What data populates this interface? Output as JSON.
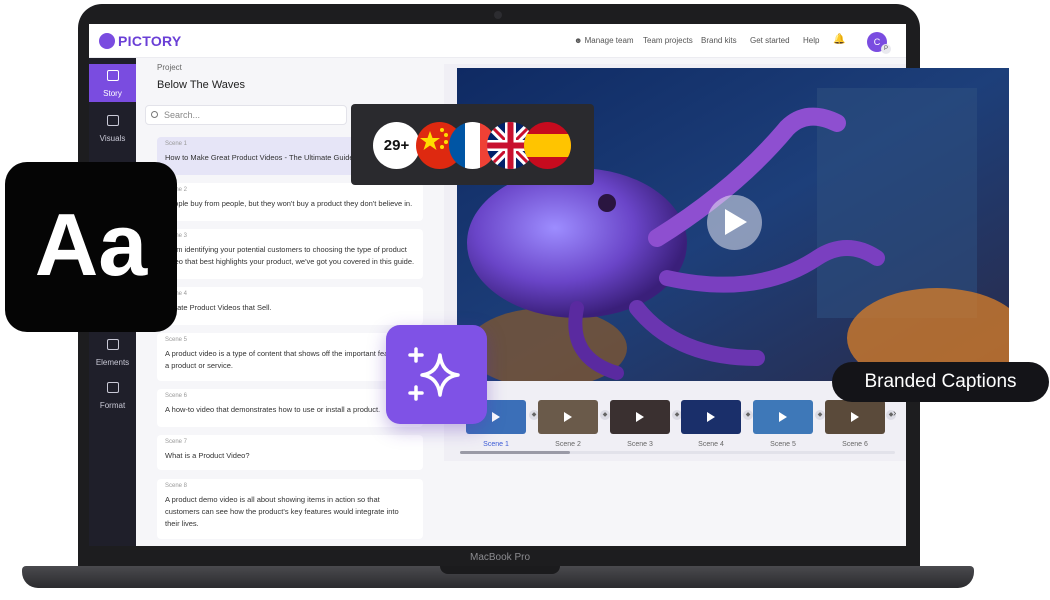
{
  "app": {
    "name": "PICTORY"
  },
  "device": {
    "label": "MacBook Pro"
  },
  "header": {
    "nav": [
      "Manage team",
      "Team projects",
      "Brand kits",
      "Get started",
      "Help"
    ],
    "avatar_letter": "C",
    "avatar_badge": "P"
  },
  "sidebar": {
    "items": [
      {
        "label": "Story",
        "icon": "story-icon",
        "active": true
      },
      {
        "label": "Visuals",
        "icon": "visuals-icon",
        "active": false
      },
      {
        "label": "Elements",
        "icon": "elements-icon",
        "active": false
      },
      {
        "label": "Format",
        "icon": "format-icon",
        "active": false
      }
    ]
  },
  "project": {
    "label": "Project",
    "title": "Below The Waves"
  },
  "search": {
    "placeholder": "Search..."
  },
  "scenes": [
    {
      "num": "Scene 1",
      "text": "How to Make Great Product Videos - The Ultimate Guide"
    },
    {
      "num": "Scene 2",
      "text": "People buy from people, but they won't buy a product they don't believe in."
    },
    {
      "num": "Scene 3",
      "text": "From identifying your potential customers to choosing the type of product video that best highlights your product, we've got you covered in this guide."
    },
    {
      "num": "Scene 4",
      "text": "Create Product Videos that Sell."
    },
    {
      "num": "Scene 5",
      "text": "A product video is a type of content that shows off the important features of a product or service."
    },
    {
      "num": "Scene 6",
      "text": "A how-to video that demonstrates how to use or install a product."
    },
    {
      "num": "Scene 7",
      "text": "What is a Product Video?"
    },
    {
      "num": "Scene 8",
      "text": "A product demo video is all about showing items in action so that customers can see how the product's key features would integrate into their lives."
    }
  ],
  "thumbnails": [
    "Scene 1",
    "Scene 2",
    "Scene 3",
    "Scene 4",
    "Scene 5",
    "Scene 6"
  ],
  "overlays": {
    "typography_sample": "Aa",
    "language_count": "29+",
    "flags": [
      "china-flag",
      "france-flag",
      "uk-flag",
      "spain-flag"
    ],
    "caption_label": "Branded Captions",
    "magic_icon": "sparkle-icon"
  },
  "colors": {
    "brand": "#7a4ce0",
    "sidebar": "#1f1f2a",
    "active_scene": "#e6e5f7"
  }
}
